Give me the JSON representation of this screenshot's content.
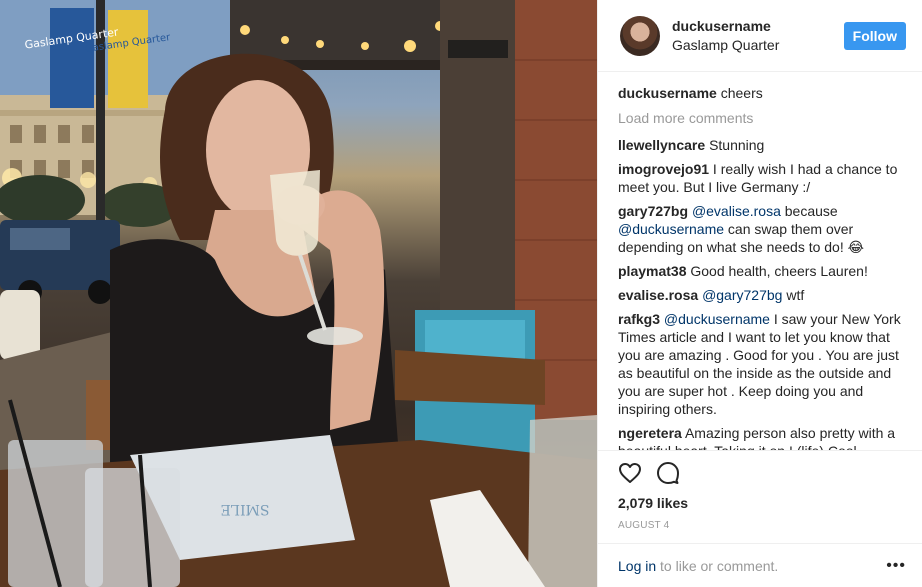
{
  "post": {
    "username": "duckusername",
    "location": "Gaslamp Quarter",
    "follow_label": "Follow",
    "caption": {
      "user": "duckusername",
      "text": "cheers"
    },
    "load_more": "Load more comments",
    "comments": [
      {
        "user": "llewellyncare",
        "parts": [
          {
            "t": "Stunning"
          }
        ]
      },
      {
        "user": "imogrovejo91",
        "parts": [
          {
            "t": "I really wish I had a chance to meet you. But I live Germany :/"
          }
        ]
      },
      {
        "user": "gary727bg",
        "parts": [
          {
            "m": "@evalise.rosa"
          },
          {
            "t": " because "
          },
          {
            "m": "@duckusername"
          },
          {
            "t": " can swap them over depending on what she needs to do! 😂"
          }
        ]
      },
      {
        "user": "playmat38",
        "parts": [
          {
            "t": "Good health, cheers Lauren!"
          }
        ]
      },
      {
        "user": "evalise.rosa",
        "parts": [
          {
            "m": "@gary727bg"
          },
          {
            "t": " wtf"
          }
        ]
      },
      {
        "user": "rafkg3",
        "parts": [
          {
            "m": "@duckusername"
          },
          {
            "t": " I saw your New York Times article and I want to let you know that you are amazing . Good for you . You are just as beautiful on the inside as the outside and you are super hot . Keep doing you and inspiring others."
          }
        ]
      },
      {
        "user": "ngeretera",
        "parts": [
          {
            "t": "Amazing person also pretty with a beautiful heart. Taking it on ! (life) Cool"
          }
        ]
      }
    ],
    "likes": "2,079 likes",
    "date": "AUGUST 4",
    "login_link": "Log in",
    "login_text": " to like or comment.",
    "more_label": "•••",
    "icons": {
      "like": "heart-icon",
      "comment": "comment-icon",
      "more": "more-options-icon"
    },
    "colors": {
      "accent": "#3897f0",
      "link": "#003569",
      "muted": "#999999"
    }
  },
  "photo": {
    "banner_1": "Gaslamp Quarter",
    "banner_2": "Gaslamp Quarter",
    "menu_text": "SMILE"
  }
}
